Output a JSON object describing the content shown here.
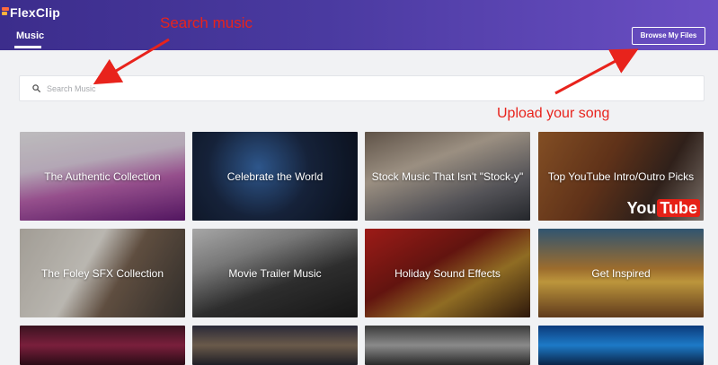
{
  "app": {
    "logo_text": "FlexClip"
  },
  "header": {
    "tab": "Music",
    "browse_button": "Browse My Files"
  },
  "search": {
    "placeholder": "Search Music"
  },
  "cards": [
    {
      "title": "The Authentic Collection"
    },
    {
      "title": "Celebrate the World"
    },
    {
      "title": "Stock Music That Isn't \"Stock-y\""
    },
    {
      "title": "Top YouTube Intro/Outro Picks",
      "badge": "You",
      "badge_tube": "Tube"
    },
    {
      "title": "The Foley SFX Collection"
    },
    {
      "title": "Movie Trailer Music"
    },
    {
      "title": "Holiday Sound Effects"
    },
    {
      "title": "Get Inspired"
    },
    {
      "title": ""
    },
    {
      "title": ""
    },
    {
      "title": ""
    },
    {
      "title": ""
    }
  ],
  "annotations": {
    "search": "Search music",
    "upload": "Upload your song"
  },
  "colors": {
    "header_start": "#3c2d8c",
    "header_end": "#6b4fc4",
    "annotation_red": "#e8231c",
    "page_bg": "#f1f2f4"
  },
  "icons": {
    "search": "search-icon",
    "logo": "flexclip-logo-icon"
  }
}
